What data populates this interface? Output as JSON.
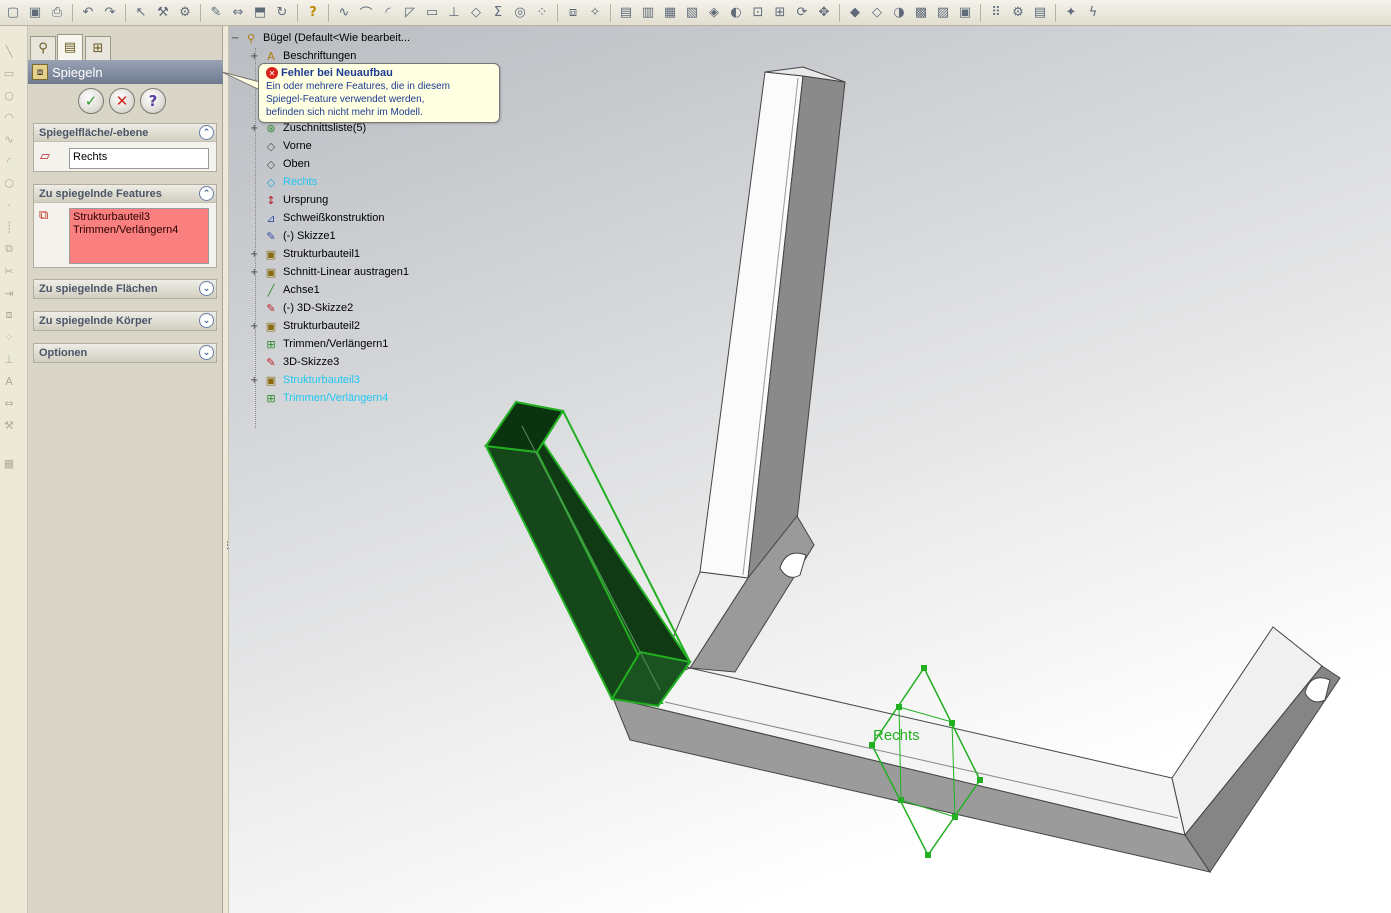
{
  "toolbar": {
    "icons": [
      "new-icon",
      "save-icon",
      "print-icon",
      "undo-icon",
      "redo-icon",
      "select-icon",
      "rebuild-icon",
      "options-icon",
      "sketch-icon",
      "smart-dimension-icon",
      "extrude-icon",
      "revolve-icon",
      "sweep-icon",
      "loft-icon",
      "fillet-icon",
      "chamfer-icon",
      "shell-icon",
      "rib-icon",
      "draft-icon",
      "hole-icon",
      "pattern-icon",
      "mirror-icon",
      "reference-geometry-icon",
      "curves-icon",
      "help-icon"
    ]
  },
  "property_manager": {
    "tabs": [
      "feature-manager-tab",
      "property-manager-tab",
      "configuration-manager-tab"
    ],
    "title": "Spiegeln",
    "buttons": {
      "ok": "✓",
      "cancel": "✕",
      "help": "?"
    },
    "groups": [
      {
        "header": "Spiegelfläche/-ebene",
        "expanded": true,
        "field_value": "Rechts"
      },
      {
        "header": "Zu spiegelnde Features",
        "expanded": true,
        "items": [
          "Strukturbauteil3",
          "Trimmen/Verlängern4"
        ]
      },
      {
        "header": "Zu spiegelnde Flächen",
        "expanded": false
      },
      {
        "header": "Zu spiegelnde Körper",
        "expanded": false
      },
      {
        "header": "Optionen",
        "expanded": false
      }
    ]
  },
  "tree": {
    "root": "Bügel  (Default<Wie bearbeit...",
    "items": [
      {
        "label": "Beschriftungen",
        "expand": "+",
        "icon": "annotations-icon",
        "selected": false
      },
      {
        "label": "Zuschnittsliste(5)",
        "expand": "+",
        "icon": "cut-list-icon",
        "selected": false
      },
      {
        "label": "Vorne",
        "expand": "",
        "icon": "plane-icon",
        "selected": false
      },
      {
        "label": "Oben",
        "expand": "",
        "icon": "plane-icon",
        "selected": false
      },
      {
        "label": "Rechts",
        "expand": "",
        "icon": "plane-icon",
        "selected": true
      },
      {
        "label": "Ursprung",
        "expand": "",
        "icon": "origin-icon",
        "selected": false
      },
      {
        "label": "Schweißkonstruktion",
        "expand": "",
        "icon": "weldment-icon",
        "selected": false
      },
      {
        "label": "(-) Skizze1",
        "expand": "",
        "icon": "sketch-icon",
        "selected": false
      },
      {
        "label": "Strukturbauteil1",
        "expand": "+",
        "icon": "structural-member-icon",
        "selected": false
      },
      {
        "label": "Schnitt-Linear austragen1",
        "expand": "+",
        "icon": "extruded-cut-icon",
        "selected": false
      },
      {
        "label": "Achse1",
        "expand": "",
        "icon": "axis-icon",
        "selected": false
      },
      {
        "label": "(-) 3D-Skizze2",
        "expand": "",
        "icon": "3d-sketch-icon",
        "selected": false
      },
      {
        "label": "Strukturbauteil2",
        "expand": "+",
        "icon": "structural-member-icon",
        "selected": false
      },
      {
        "label": "Trimmen/Verlängern1",
        "expand": "",
        "icon": "trim-extend-icon",
        "selected": false
      },
      {
        "label": "3D-Skizze3",
        "expand": "",
        "icon": "3d-sketch-icon",
        "selected": false
      },
      {
        "label": "Strukturbauteil3",
        "expand": "+",
        "icon": "structural-member-icon",
        "selected": true
      },
      {
        "label": "Trimmen/Verlängern4",
        "expand": "",
        "icon": "trim-extend-icon",
        "selected": true
      }
    ]
  },
  "tooltip": {
    "title": "Fehler bei Neuaufbau",
    "body_lines": [
      "Ein oder mehrere Features, die in diesem",
      "Spiegel-Feature verwendet werden,",
      "befinden sich nicht mehr im Modell."
    ]
  },
  "viewport": {
    "plane_label": "Rechts",
    "colors": {
      "selection_green": "#22b022",
      "selected_fill": "#0f3a14",
      "tree_selected": "#20c8f0",
      "error_pink": "#fa8080"
    }
  }
}
